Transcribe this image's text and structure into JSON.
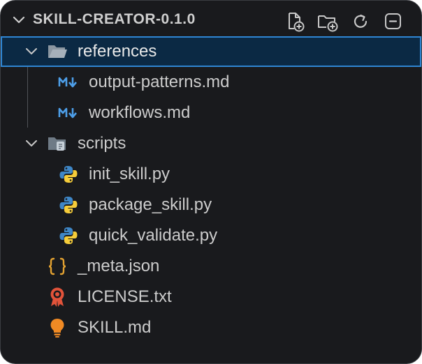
{
  "explorer": {
    "title": "SKILL-CREATOR-0.1.0",
    "actions": [
      {
        "name": "new-file-icon"
      },
      {
        "name": "new-folder-icon"
      },
      {
        "name": "refresh-icon"
      },
      {
        "name": "collapse-all-icon"
      }
    ]
  },
  "tree": {
    "items": [
      {
        "label": "references",
        "type": "folder",
        "expanded": true,
        "selected": true
      },
      {
        "label": "output-patterns.md",
        "type": "markdown"
      },
      {
        "label": "workflows.md",
        "type": "markdown"
      },
      {
        "label": "scripts",
        "type": "folder",
        "expanded": true
      },
      {
        "label": "init_skill.py",
        "type": "python"
      },
      {
        "label": "package_skill.py",
        "type": "python"
      },
      {
        "label": "quick_validate.py",
        "type": "python"
      },
      {
        "label": "_meta.json",
        "type": "json"
      },
      {
        "label": "LICENSE.txt",
        "type": "license"
      },
      {
        "label": "SKILL.md",
        "type": "skill"
      }
    ]
  },
  "colors": {
    "background": "#191a1d",
    "selection_bg": "#0b2944",
    "selection_border": "#2f86d3",
    "markdown_icon": "#4d9ee8",
    "json_icon": "#e5a331",
    "license_icon": "#e2533a",
    "skill_icon": "#f08a24"
  }
}
